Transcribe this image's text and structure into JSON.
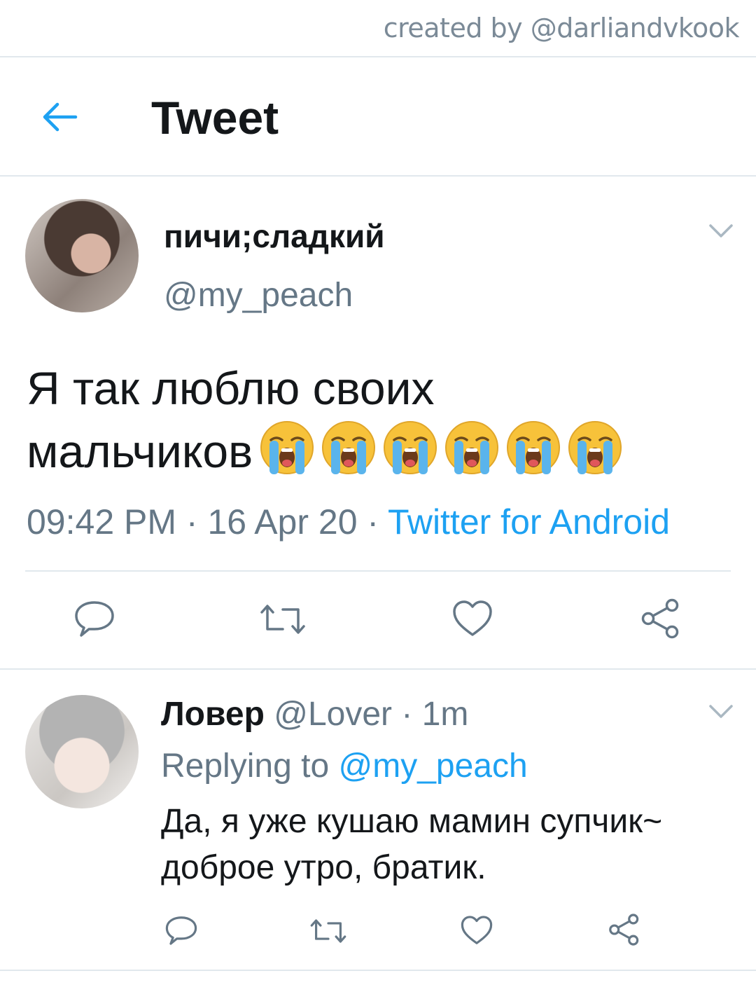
{
  "credit": "created by @darliandvkook",
  "header": {
    "title": "Tweet",
    "back_icon": "arrow-left-icon"
  },
  "colors": {
    "accent": "#1da1f2",
    "muted": "#657786",
    "divider": "#e1e8ed",
    "text": "#14171a"
  },
  "main_tweet": {
    "display_name": "пичи;сладкий",
    "handle": "@my_peach",
    "text_line1": "Я так люблю своих",
    "text_line2": "мальчиков",
    "emoji_count": 6,
    "emoji_name": "loudly-crying-face",
    "time": "09:42 PM",
    "sep1": " · ",
    "date": "16 Apr 20",
    "sep2": " · ",
    "source": "Twitter for Android",
    "actions": [
      "reply",
      "retweet",
      "like",
      "share"
    ]
  },
  "reply_tweet": {
    "display_name": "Ловер",
    "handle": "@Lover",
    "time_sep": " · ",
    "time": "1m",
    "replying_prefix": "Replying to ",
    "replying_to": "@my_peach",
    "text_line1": "Да, я уже кушаю мамин супчик~",
    "text_line2": "доброе утро, братик.",
    "actions": [
      "reply",
      "retweet",
      "like",
      "share"
    ]
  }
}
